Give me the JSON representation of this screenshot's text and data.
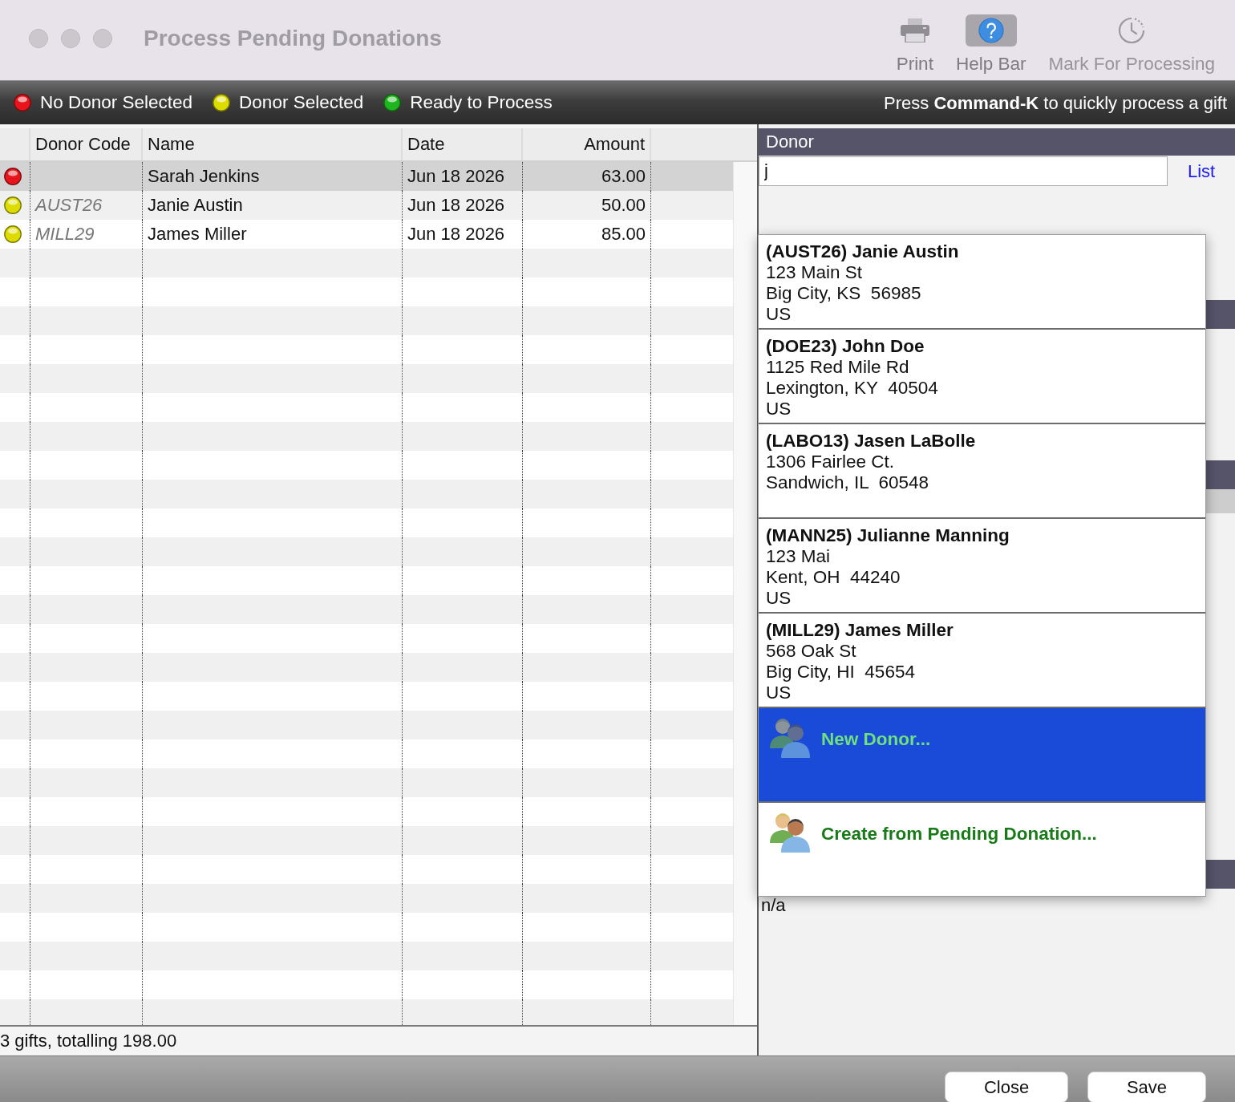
{
  "window": {
    "title": "Process Pending Donations"
  },
  "toolbar": [
    {
      "label": "Print",
      "selected": false,
      "disabled": false
    },
    {
      "label": "Help Bar",
      "selected": true,
      "disabled": false
    },
    {
      "label": "Mark For Processing",
      "selected": false,
      "disabled": true
    }
  ],
  "legend": {
    "items": [
      {
        "label": "No Donor Selected",
        "color": "#e8141c"
      },
      {
        "label": "Donor Selected",
        "color": "#dcdc00"
      },
      {
        "label": "Ready to Process",
        "color": "#1fb51f"
      }
    ],
    "hint": "Press **Command-K** to quickly process a gift"
  },
  "table": {
    "columns": [
      "Donor Code",
      "Name",
      "Date",
      "Amount"
    ],
    "rows": [
      {
        "color": "#e8141c",
        "name": "Sarah Jenkins",
        "date": "Jun 18 2026",
        "amount": "63.00",
        "selected": true
      },
      {
        "color": "#dcdc00",
        "donor_code": "AUST26",
        "name": "Janie Austin",
        "date": "Jun 18 2026",
        "amount": "50.00",
        "selected": false
      },
      {
        "color": "#dcdc00",
        "donor_code": "MILL29",
        "name": "James Miller",
        "date": "Jun 18 2026",
        "amount": "85.00",
        "selected": false
      }
    ]
  },
  "summary": "3 gifts, totalling 198.00",
  "donor_panel": {
    "title": "Donor",
    "search_value": "j",
    "list_link": "List",
    "field_text": "n/a"
  },
  "donor_menu": {
    "items": [
      {
        "kind": "donor",
        "title": "(AUST26) Janie Austin",
        "lines": [
          "123 Main St",
          "Big City, KS  56985",
          "US"
        ],
        "selected": false
      },
      {
        "kind": "donor",
        "title": "(DOE23) John Doe",
        "lines": [
          "1125 Red Mile Rd",
          "Lexington, KY  40504",
          "US"
        ],
        "selected": false
      },
      {
        "kind": "donor",
        "title": "(LABO13) Jasen LaBolle",
        "lines": [
          "1306 Fairlee Ct.",
          "Sandwich, IL  60548"
        ],
        "selected": false
      },
      {
        "kind": "donor",
        "title": "(MANN25) Julianne Manning",
        "lines": [
          "123 Mai",
          "Kent, OH  44240",
          "US"
        ],
        "selected": false
      },
      {
        "kind": "donor",
        "title": "(MILL29) James Miller",
        "lines": [
          "568 Oak St",
          "Big City, HI  45654",
          "US"
        ],
        "selected": false
      },
      {
        "kind": "action",
        "label": "New Donor...",
        "selected": true
      },
      {
        "kind": "action",
        "label": "Create from Pending Donation...",
        "selected": false
      }
    ]
  },
  "buttons": [
    "Close",
    "Save"
  ]
}
